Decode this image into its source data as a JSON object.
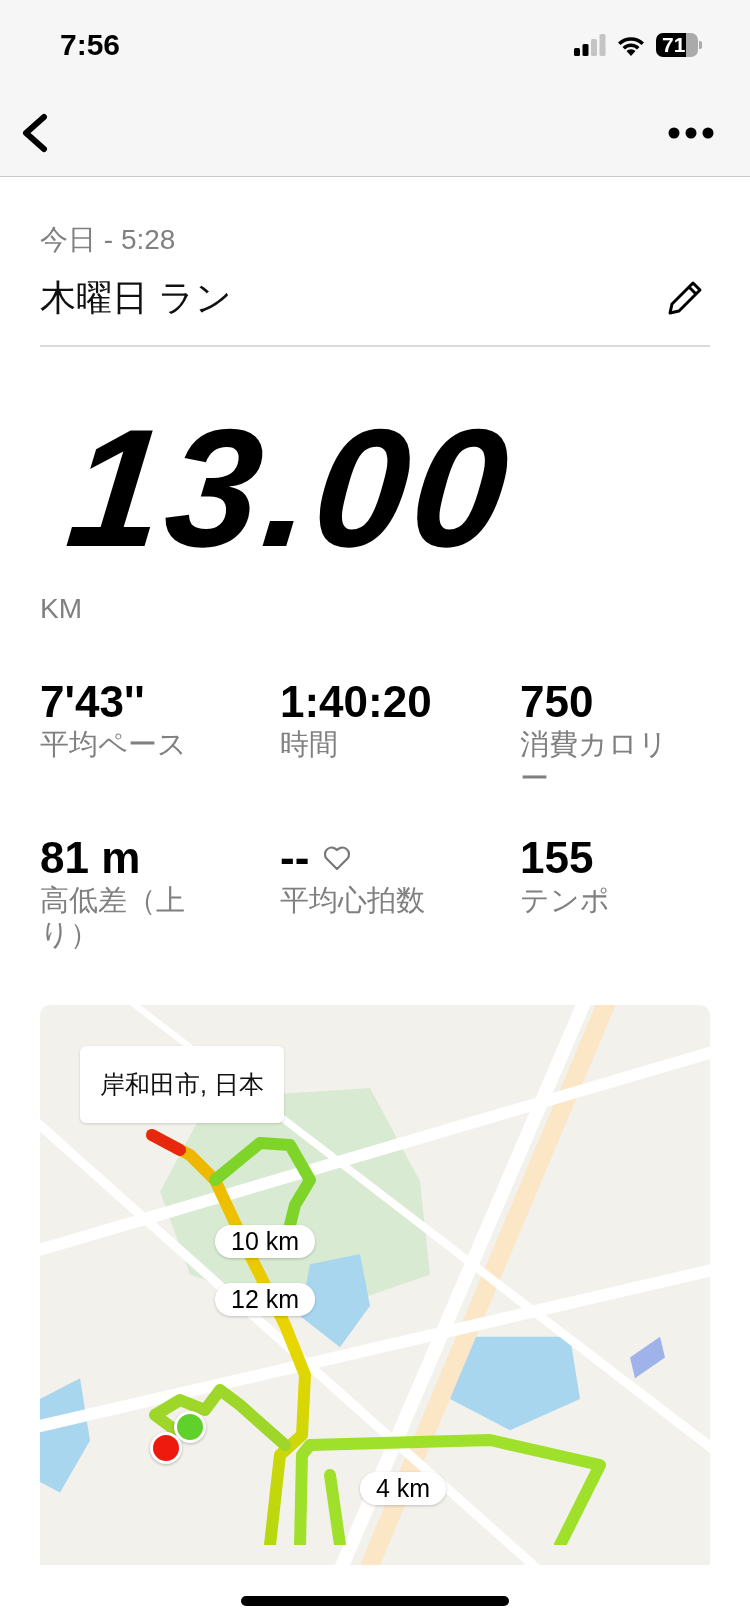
{
  "status_bar": {
    "time": "7:56",
    "battery": "71"
  },
  "activity": {
    "date": "今日 - 5:28",
    "title": "木曜日 ラン"
  },
  "distance": {
    "value": "13.00",
    "unit": "KM"
  },
  "stats": [
    {
      "kind": "plain",
      "value": "7'43''",
      "label": "平均ペース"
    },
    {
      "kind": "plain",
      "value": "1:40:20",
      "label": "時間"
    },
    {
      "kind": "plain",
      "value": "750",
      "label": "消費カロリー"
    },
    {
      "kind": "plain",
      "value": "81 m",
      "label": "高低差（上り）"
    },
    {
      "kind": "heart",
      "value": "--",
      "label": "平均心拍数"
    },
    {
      "kind": "plain",
      "value": "155",
      "label": "テンポ"
    }
  ],
  "map": {
    "kind": "picture",
    "location": "岸和田市, 日本",
    "km_markers": [
      {
        "label": "10 km"
      },
      {
        "label": "12 km"
      },
      {
        "label": "4 km"
      }
    ]
  }
}
